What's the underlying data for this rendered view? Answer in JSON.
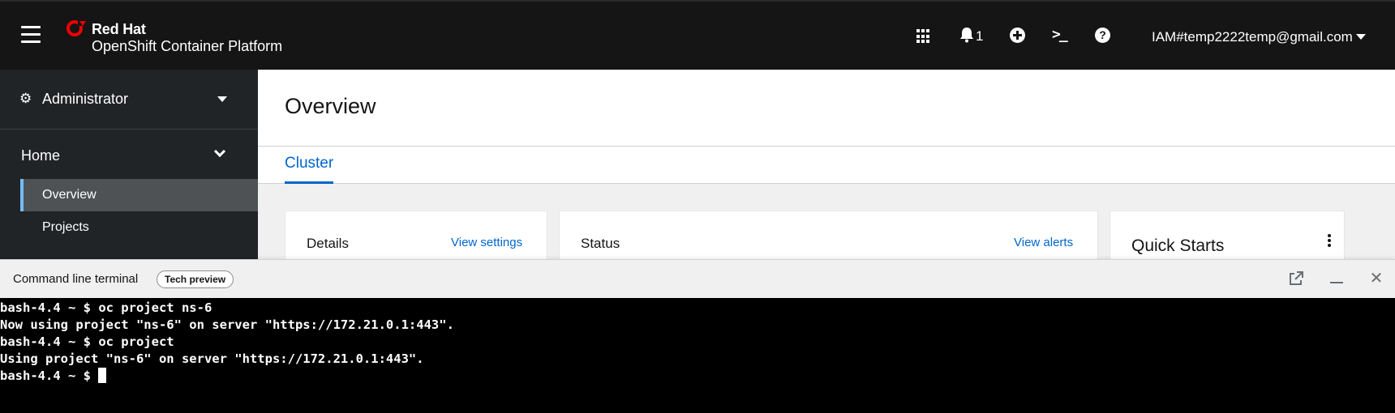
{
  "brand": {
    "company": "Red Hat",
    "product_bold": "OpenShift",
    "product_rest": " Container Platform"
  },
  "masthead": {
    "notification_count": "1",
    "help_symbol": "?",
    "terminal_symbol": ">_",
    "user": "IAM#temp2222temp@gmail.com",
    "icons": [
      "menu-icon",
      "app-launcher-icon",
      "bell-icon",
      "plus-circle-icon",
      "terminal-icon",
      "help-icon"
    ]
  },
  "sidebar": {
    "perspective": "Administrator",
    "section": "Home",
    "items": [
      {
        "label": "Overview",
        "active": true
      },
      {
        "label": "Projects",
        "active": false
      }
    ]
  },
  "main": {
    "title": "Overview",
    "tabs": [
      {
        "label": "Cluster"
      }
    ],
    "cards": {
      "details": {
        "title": "Details",
        "link": "View settings"
      },
      "status": {
        "title": "Status",
        "link": "View alerts"
      },
      "quickstarts": {
        "title": "Quick Starts"
      }
    }
  },
  "terminal_drawer": {
    "title": "Command line terminal",
    "badge": "Tech preview",
    "lines": [
      "bash-4.4 ~ $ oc project ns-6",
      "Now using project \"ns-6\" on server \"https://172.21.0.1:443\".",
      "bash-4.4 ~ $ oc project",
      "Using project \"ns-6\" on server \"https://172.21.0.1:443\".",
      "bash-4.4 ~ $ "
    ]
  },
  "colors": {
    "masthead_bg": "#151515",
    "sidebar_bg": "#212427",
    "active_indicator": "#73bcf7",
    "link": "#0066cc",
    "brand_red": "#ee0000"
  }
}
